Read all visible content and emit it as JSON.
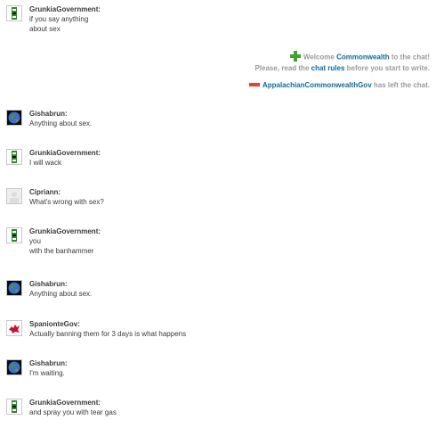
{
  "messages": [
    {
      "user": "GrunkiaGovernment:",
      "avatar": "green-flag-icon",
      "lines": [
        "if you say anything",
        "about sex"
      ]
    },
    {
      "user": "Gishabrun:",
      "avatar": "earth-globe-icon",
      "lines": [
        "Anything about sex."
      ]
    },
    {
      "user": "GrunkiaGovernment:",
      "avatar": "green-flag-icon",
      "lines": [
        "I will wack"
      ]
    },
    {
      "user": "Cipriann:",
      "avatar": "default-avatar-icon",
      "lines": [
        "What's wrong with sex?"
      ]
    },
    {
      "user": "GrunkiaGovernment:",
      "avatar": "green-flag-icon",
      "lines": [
        "you",
        "with the banhammer"
      ]
    },
    {
      "user": "Gishabrun:",
      "avatar": "earth-globe-icon",
      "lines": [
        "Anything about sex."
      ]
    },
    {
      "user": "SpanionteGov:",
      "avatar": "red-dragon-flag-icon",
      "lines": [
        "Actually banning them for 3 days is what happens"
      ]
    },
    {
      "user": "Gishabrun:",
      "avatar": "earth-globe-icon",
      "lines": [
        "I'm waiting."
      ]
    },
    {
      "user": "GrunkiaGovernment:",
      "avatar": "green-flag-icon",
      "lines": [
        "and spray you with tear gas"
      ]
    }
  ],
  "system": {
    "join": {
      "prefix": "Welcome ",
      "name": "Commonwealth",
      "suffix": " to the chat!",
      "rules_prefix": "Please, read the ",
      "rules_link": "chat rules",
      "rules_suffix": " before you start to write."
    },
    "leave": {
      "name": "AppalachianCommonwealthGov",
      "suffix": " has left the chat."
    }
  },
  "colors": {
    "link": "#0b6aa2",
    "system_text": "#9a9a9a",
    "join_icon": "#3aa52a",
    "leave_icon": "#e0472e"
  }
}
